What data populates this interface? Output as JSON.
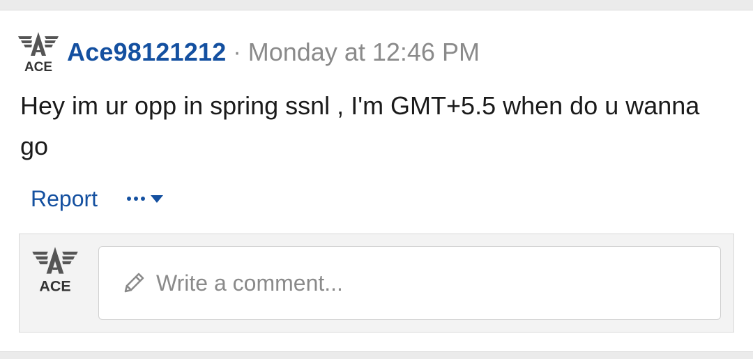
{
  "post": {
    "author": "Ace98121212",
    "separator": "·",
    "timestamp": "Monday at 12:46 PM",
    "body": "Hey im ur opp in spring ssnl , I'm GMT+5.5 when do u wanna go",
    "avatar_text": "ACE",
    "avatar_icon": "ace-wings-logo"
  },
  "actions": {
    "report_label": "Report",
    "more_icon": "ellipsis-icon",
    "caret_icon": "caret-down-icon"
  },
  "comment": {
    "avatar_text": "ACE",
    "placeholder": "Write a comment...",
    "pencil_icon": "pencil-icon"
  },
  "colors": {
    "link": "#1450a0",
    "muted": "#8a8a8a",
    "text": "#1a1a1a",
    "background": "#ebebeb"
  }
}
